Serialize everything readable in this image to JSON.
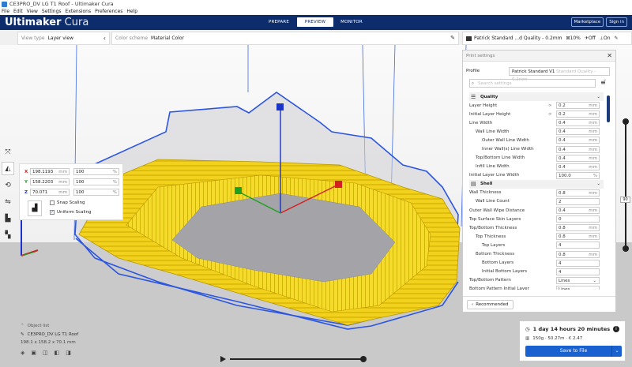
{
  "window": {
    "title": "CE3PRO_DV LG T1 Roof - Ultimaker Cura"
  },
  "menu": [
    "File",
    "Edit",
    "View",
    "Settings",
    "Extensions",
    "Preferences",
    "Help"
  ],
  "header": {
    "brand_bold": "Ultimaker",
    "brand_light": "Cura",
    "stages": [
      "PREPARE",
      "PREVIEW",
      "MONITOR"
    ],
    "active_stage": "PREVIEW",
    "marketplace": "Marketplace",
    "signin": "Sign in"
  },
  "toolbar": {
    "view_type_label": "View type",
    "view_type_value": "Layer view",
    "color_scheme_label": "Color scheme",
    "color_scheme_value": "Material Color",
    "print_setup_profile": "Patrick Standard ...d Quality - 0.2mm",
    "infill": "10%",
    "support": "Off",
    "adhesion": "On"
  },
  "scale": {
    "x_label": "X",
    "x_mm": "198.1193",
    "x_pct": "100",
    "y_label": "Y",
    "y_mm": "158.2203",
    "y_pct": "100",
    "z_label": "Z",
    "z_mm": "70.071",
    "z_pct": "100",
    "mm_unit": "mm",
    "pct_unit": "%",
    "snap_scaling": "Snap Scaling",
    "uniform_scaling": "Uniform Scaling"
  },
  "object_list": {
    "title": "Object list",
    "file_name": "CE3PRO_DV LG T1 Roof",
    "dimensions": "198.1 x 158.2 x 70.1 mm"
  },
  "layer_slider": {
    "value": "90",
    "level": 0.62
  },
  "print_settings": {
    "title": "Print settings",
    "profile_label": "Profile",
    "profile_value": "Patrick Standard V1",
    "profile_suffix": "Standard Quality - 0.2mm",
    "search_placeholder": "Search settings",
    "sections": [
      {
        "name": "Quality",
        "rows": [
          {
            "name": "Layer Height",
            "indent": 0,
            "value": "0.2",
            "unit": "mm",
            "linked": true
          },
          {
            "name": "Initial Layer Height",
            "indent": 0,
            "value": "0.2",
            "unit": "mm",
            "linked": true
          },
          {
            "name": "Line Width",
            "indent": 0,
            "value": "0.4",
            "unit": "mm"
          },
          {
            "name": "Wall Line Width",
            "indent": 1,
            "value": "0.4",
            "unit": "mm"
          },
          {
            "name": "Outer Wall Line Width",
            "indent": 2,
            "value": "0.4",
            "unit": "mm"
          },
          {
            "name": "Inner Wall(s) Line Width",
            "indent": 2,
            "value": "0.4",
            "unit": "mm"
          },
          {
            "name": "Top/Bottom Line Width",
            "indent": 1,
            "value": "0.4",
            "unit": "mm"
          },
          {
            "name": "Infill Line Width",
            "indent": 1,
            "value": "0.4",
            "unit": "mm"
          },
          {
            "name": "Initial Layer Line Width",
            "indent": 0,
            "value": "100.0",
            "unit": "%"
          }
        ]
      },
      {
        "name": "Shell",
        "rows": [
          {
            "name": "Wall Thickness",
            "indent": 0,
            "value": "0.8",
            "unit": "mm"
          },
          {
            "name": "Wall Line Count",
            "indent": 1,
            "value": "2",
            "unit": ""
          },
          {
            "name": "Outer Wall Wipe Distance",
            "indent": 0,
            "value": "0.4",
            "unit": "mm"
          },
          {
            "name": "Top Surface Skin Layers",
            "indent": 0,
            "value": "0",
            "unit": ""
          },
          {
            "name": "Top/Bottom Thickness",
            "indent": 0,
            "value": "0.8",
            "unit": "mm"
          },
          {
            "name": "Top Thickness",
            "indent": 1,
            "value": "0.8",
            "unit": "mm"
          },
          {
            "name": "Top Layers",
            "indent": 2,
            "value": "4",
            "unit": ""
          },
          {
            "name": "Bottom Thickness",
            "indent": 1,
            "value": "0.8",
            "unit": "mm"
          },
          {
            "name": "Bottom Layers",
            "indent": 2,
            "value": "4",
            "unit": ""
          },
          {
            "name": "Initial Bottom Layers",
            "indent": 2,
            "value": "4",
            "unit": ""
          },
          {
            "name": "Top/Bottom Pattern",
            "indent": 0,
            "value": "Lines",
            "unit": "",
            "select": true
          },
          {
            "name": "Bottom Pattern Initial Layer",
            "indent": 0,
            "value": "Lines",
            "unit": "",
            "select": true
          }
        ]
      }
    ],
    "recommended": "Recommended"
  },
  "output": {
    "print_time": "1 day 14 hours 20 minutes",
    "material": "150g · 50.27m · € 2.47",
    "save_button": "Save to File"
  }
}
